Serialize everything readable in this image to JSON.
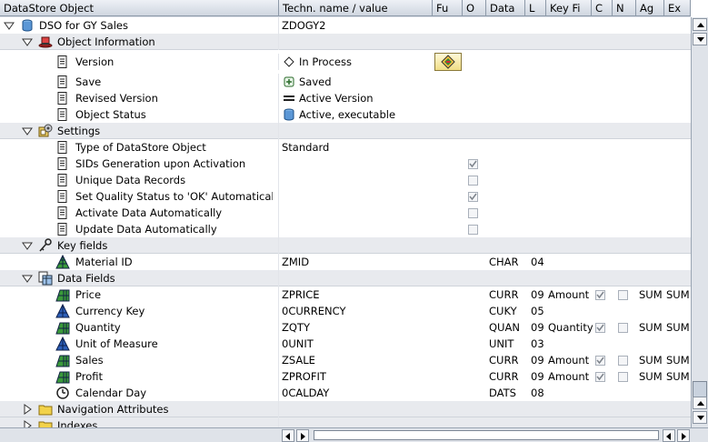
{
  "columns": [
    {
      "key": "object",
      "label": "DataStore Object"
    },
    {
      "key": "tech",
      "label": "Techn. name / value"
    },
    {
      "key": "fu",
      "label": "Fu"
    },
    {
      "key": "o",
      "label": "O"
    },
    {
      "key": "data",
      "label": "Data"
    },
    {
      "key": "l",
      "label": "L"
    },
    {
      "key": "keyfi",
      "label": "Key Fi"
    },
    {
      "key": "c",
      "label": "C"
    },
    {
      "key": "n",
      "label": "N"
    },
    {
      "key": "ag",
      "label": "Ag"
    },
    {
      "key": "ex",
      "label": "Ex"
    }
  ],
  "rows": [
    {
      "level": 0,
      "kind": "root",
      "label": "DSO for GY Sales",
      "tech": "ZDOGY2",
      "icon": "cylinder-icon",
      "expander": "open"
    },
    {
      "level": 1,
      "kind": "group",
      "label": "Object Information",
      "icon": "hat-icon",
      "expander": "open"
    },
    {
      "level": 2,
      "kind": "item",
      "label": "Version",
      "icon": "document-icon",
      "value": "In Process",
      "value_icon": "diamond-icon",
      "has_status_button": true
    },
    {
      "level": 2,
      "kind": "item",
      "label": "Save",
      "icon": "document-icon",
      "value": "Saved",
      "value_icon": "plus-icon"
    },
    {
      "level": 2,
      "kind": "item",
      "label": "Revised Version",
      "icon": "document-icon",
      "value": "Active Version",
      "value_icon": "equals-icon"
    },
    {
      "level": 2,
      "kind": "item",
      "label": "Object Status",
      "icon": "document-icon",
      "value": "Active, executable",
      "value_icon": "cylinder-icon"
    },
    {
      "level": 1,
      "kind": "group",
      "label": "Settings",
      "icon": "settings-icon",
      "expander": "open"
    },
    {
      "level": 2,
      "kind": "item",
      "label": "Type of DataStore Object",
      "icon": "document-icon",
      "value": "Standard"
    },
    {
      "level": 2,
      "kind": "item",
      "label": "SIDs Generation upon Activation",
      "icon": "document-icon",
      "fu_check": "checked"
    },
    {
      "level": 2,
      "kind": "item",
      "label": "Unique Data Records",
      "icon": "document-icon",
      "fu_check": "unchecked"
    },
    {
      "level": 2,
      "kind": "item",
      "label": "Set Quality Status to 'OK' Automatically",
      "icon": "document-icon",
      "fu_check": "checked"
    },
    {
      "level": 2,
      "kind": "item",
      "label": "Activate Data Automatically",
      "icon": "document-icon",
      "fu_check": "unchecked"
    },
    {
      "level": 2,
      "kind": "item",
      "label": "Update Data Automatically",
      "icon": "document-icon",
      "fu_check": "unchecked"
    },
    {
      "level": 1,
      "kind": "group",
      "label": "Key fields",
      "icon": "key-icon",
      "expander": "open"
    },
    {
      "level": 2,
      "kind": "item",
      "label": "Material ID",
      "icon": "characteristic-icon",
      "tech": "ZMID",
      "data": "CHAR",
      "l": "04"
    },
    {
      "level": 1,
      "kind": "group",
      "label": "Data Fields",
      "icon": "datafields-icon",
      "expander": "open"
    },
    {
      "level": 2,
      "kind": "item",
      "label": "Price",
      "icon": "keyfigure-icon",
      "tech": "ZPRICE",
      "data": "CURR",
      "l": "09",
      "keyfi": "Amount",
      "c_check": "checked",
      "n_check": "unchecked",
      "ag": "SUM",
      "ex": "SUM"
    },
    {
      "level": 2,
      "kind": "item",
      "label": "Currency Key",
      "icon": "unit-icon",
      "tech": "0CURRENCY",
      "data": "CUKY",
      "l": "05"
    },
    {
      "level": 2,
      "kind": "item",
      "label": "Quantity",
      "icon": "keyfigure-icon",
      "tech": "ZQTY",
      "data": "QUAN",
      "l": "09",
      "keyfi": "Quantity",
      "c_check": "checked",
      "n_check": "unchecked",
      "ag": "SUM",
      "ex": "SUM"
    },
    {
      "level": 2,
      "kind": "item",
      "label": "Unit of Measure",
      "icon": "unit-icon",
      "tech": "0UNIT",
      "data": "UNIT",
      "l": "03"
    },
    {
      "level": 2,
      "kind": "item",
      "label": "Sales",
      "icon": "keyfigure-icon",
      "tech": "ZSALE",
      "data": "CURR",
      "l": "09",
      "keyfi": "Amount",
      "c_check": "checked",
      "n_check": "unchecked",
      "ag": "SUM",
      "ex": "SUM"
    },
    {
      "level": 2,
      "kind": "item",
      "label": "Profit",
      "icon": "keyfigure-icon",
      "tech": "ZPROFIT",
      "data": "CURR",
      "l": "09",
      "keyfi": "Amount",
      "c_check": "checked",
      "n_check": "unchecked",
      "ag": "SUM",
      "ex": "SUM"
    },
    {
      "level": 2,
      "kind": "item",
      "label": "Calendar Day",
      "icon": "clock-icon",
      "tech": "0CALDAY",
      "data": "DATS",
      "l": "08"
    },
    {
      "level": 1,
      "kind": "group2",
      "label": "Navigation Attributes",
      "icon": "folder-icon",
      "expander": "closed"
    },
    {
      "level": 1,
      "kind": "group2",
      "label": "Indexes",
      "icon": "folder-icon",
      "expander": "closed"
    }
  ],
  "colors": {
    "header_bg": "#cfd6e0",
    "group_bg": "#e8eaee",
    "accent": "#0a5aa8"
  }
}
